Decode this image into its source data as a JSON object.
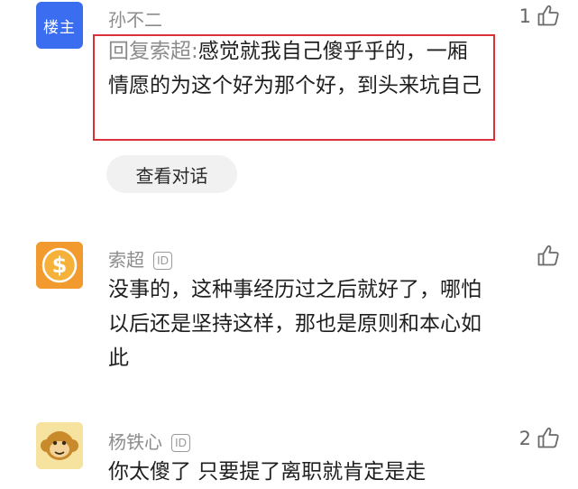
{
  "comments": [
    {
      "avatar_label": "楼主",
      "author": "孙不二",
      "likes": "1",
      "reply_prefix": "回复索超:",
      "text": "感觉就我自己傻乎乎的，一厢情愿的为这个好为那个好，到头来坑自己",
      "view_conversation_label": "查看对话",
      "highlight_color": "#d9303a"
    },
    {
      "author": "索超",
      "id_badge": "ID",
      "likes": "",
      "text": "没事的，这种事经历过之后就好了，哪怕以后还是坚持这样，那也是原则和本心如此"
    },
    {
      "author": "杨铁心",
      "id_badge": "ID",
      "likes": "2",
      "text": "你太傻了 只要提了离职就肯定是走"
    }
  ],
  "colors": {
    "host_avatar": "#3a6df0",
    "coin_avatar": "#f29a2e",
    "monkey_avatar": "#f2c83a"
  },
  "icons": [
    "thumbs-up-icon",
    "dollar-coin-icon",
    "monkey-face-icon"
  ]
}
